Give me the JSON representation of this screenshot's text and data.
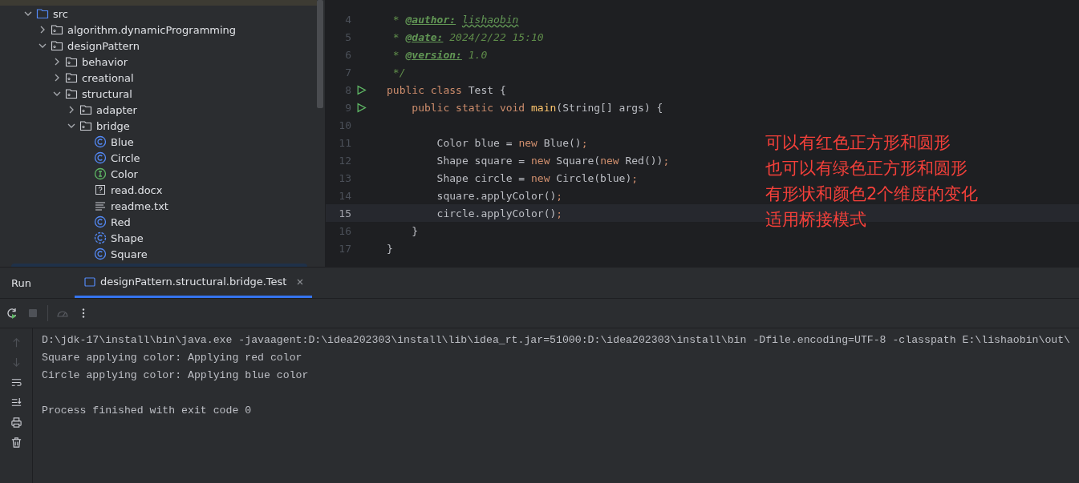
{
  "project_tree": {
    "items": [
      {
        "label": "src",
        "kind": "folder",
        "expanded": true,
        "selected": false,
        "children": [
          {
            "label": "algorithm.dynamicProgramming",
            "kind": "package",
            "expanded": false,
            "selected": false
          },
          {
            "label": "designPattern",
            "kind": "package",
            "expanded": true,
            "selected": false,
            "children": [
              {
                "label": "behavior",
                "kind": "package",
                "expanded": false,
                "selected": false
              },
              {
                "label": "creational",
                "kind": "package",
                "expanded": false,
                "selected": false
              },
              {
                "label": "structural",
                "kind": "package",
                "expanded": true,
                "selected": false,
                "children": [
                  {
                    "label": "adapter",
                    "kind": "package",
                    "expanded": false,
                    "selected": false
                  },
                  {
                    "label": "bridge",
                    "kind": "package",
                    "expanded": true,
                    "selected": false,
                    "children": [
                      {
                        "label": "Blue",
                        "kind": "class",
                        "selected": false
                      },
                      {
                        "label": "Circle",
                        "kind": "class",
                        "selected": false
                      },
                      {
                        "label": "Color",
                        "kind": "interface",
                        "selected": false
                      },
                      {
                        "label": "read.docx",
                        "kind": "unknown",
                        "selected": false
                      },
                      {
                        "label": "readme.txt",
                        "kind": "text",
                        "selected": false
                      },
                      {
                        "label": "Red",
                        "kind": "class",
                        "selected": false
                      },
                      {
                        "label": "Shape",
                        "kind": "abstract",
                        "selected": false
                      },
                      {
                        "label": "Square",
                        "kind": "class",
                        "selected": false
                      }
                    ]
                  }
                ]
              }
            ]
          }
        ]
      }
    ]
  },
  "editor": {
    "lines": [
      {
        "number": "4",
        "current": false,
        "run": false,
        "tokens": [
          {
            "text": " * ",
            "kind": "doc"
          },
          {
            "text": "@author:",
            "kind": "tag"
          },
          {
            "text": "lishaobin",
            "kind": "typo"
          }
        ]
      },
      {
        "number": "5",
        "current": false,
        "run": false,
        "tokens": [
          {
            "text": " * ",
            "kind": "doc"
          },
          {
            "text": "@date:",
            "kind": "tag"
          },
          {
            "text": " 2024/2/22 15:10",
            "kind": "doc"
          }
        ]
      },
      {
        "number": "6",
        "current": false,
        "run": false,
        "tokens": [
          {
            "text": " * ",
            "kind": "doc"
          },
          {
            "text": "@version:",
            "kind": "tag"
          },
          {
            "text": " 1.0",
            "kind": "doc"
          }
        ]
      },
      {
        "number": "7",
        "current": false,
        "run": false,
        "tokens": [
          {
            "text": " */",
            "kind": "doc"
          }
        ]
      },
      {
        "number": "8",
        "current": false,
        "run": true,
        "tokens": [
          {
            "text": "public class ",
            "kind": "keyword"
          },
          {
            "text": "Test {",
            "kind": "plain"
          }
        ]
      },
      {
        "number": "9",
        "current": false,
        "run": true,
        "tokens": [
          {
            "text": "    public static void ",
            "kind": "keyword"
          },
          {
            "text": "main",
            "kind": "method"
          },
          {
            "text": "(String[] args) {",
            "kind": "plain"
          }
        ]
      },
      {
        "number": "10",
        "current": false,
        "run": false
      },
      {
        "number": "11",
        "current": false,
        "run": false,
        "tokens": [
          {
            "text": "        Color blue = ",
            "kind": "plain"
          },
          {
            "text": "new ",
            "kind": "keyword"
          },
          {
            "text": "Blue()",
            "kind": "plain"
          },
          {
            "text": ";",
            "kind": "keyword"
          }
        ]
      },
      {
        "number": "12",
        "current": false,
        "run": false,
        "tokens": [
          {
            "text": "        Shape square = ",
            "kind": "plain"
          },
          {
            "text": "new ",
            "kind": "keyword"
          },
          {
            "text": "Square(",
            "kind": "plain"
          },
          {
            "text": "new ",
            "kind": "keyword"
          },
          {
            "text": "Red())",
            "kind": "plain"
          },
          {
            "text": ";",
            "kind": "keyword"
          }
        ]
      },
      {
        "number": "13",
        "current": false,
        "run": false,
        "tokens": [
          {
            "text": "        Shape circle = ",
            "kind": "plain"
          },
          {
            "text": "new ",
            "kind": "keyword"
          },
          {
            "text": "Circle(blue)",
            "kind": "plain"
          },
          {
            "text": ";",
            "kind": "keyword"
          }
        ]
      },
      {
        "number": "14",
        "current": false,
        "run": false,
        "tokens": [
          {
            "text": "        square.applyColor()",
            "kind": "plain"
          },
          {
            "text": ";",
            "kind": "keyword"
          }
        ]
      },
      {
        "number": "15",
        "current": true,
        "run": false,
        "tokens": [
          {
            "text": "        circle.applyColor()",
            "kind": "plain"
          },
          {
            "text": ";",
            "kind": "keyword"
          }
        ]
      },
      {
        "number": "16",
        "current": false,
        "run": false,
        "tokens": [
          {
            "text": "    }",
            "kind": "plain"
          }
        ]
      },
      {
        "number": "17",
        "current": false,
        "run": false,
        "tokens": [
          {
            "text": "}",
            "kind": "plain"
          }
        ]
      }
    ],
    "annotation": [
      "可以有红色正方形和圆形",
      "也可以有绿色正方形和圆形",
      "有形状和颜色2个维度的变化",
      "适用桥接模式"
    ]
  },
  "run_panel": {
    "title": "Run",
    "tabs": [
      {
        "label": "designPattern.structural.bridge.Test",
        "selected": true
      }
    ],
    "console": [
      {
        "text": "D:\\jdk-17\\install\\bin\\java.exe -javaagent:D:\\idea202303\\install\\lib\\idea_rt.jar=51000:D:\\idea202303\\install\\bin -Dfile.encoding=UTF-8 -classpath E:\\lishaobin\\out\\",
        "kind": "output"
      },
      {
        "text": "Square applying color: Applying red color",
        "kind": "output"
      },
      {
        "text": "Circle applying color: Applying blue color",
        "kind": "output"
      },
      {
        "text": "Process finished with exit code 0",
        "kind": "exit"
      }
    ]
  }
}
